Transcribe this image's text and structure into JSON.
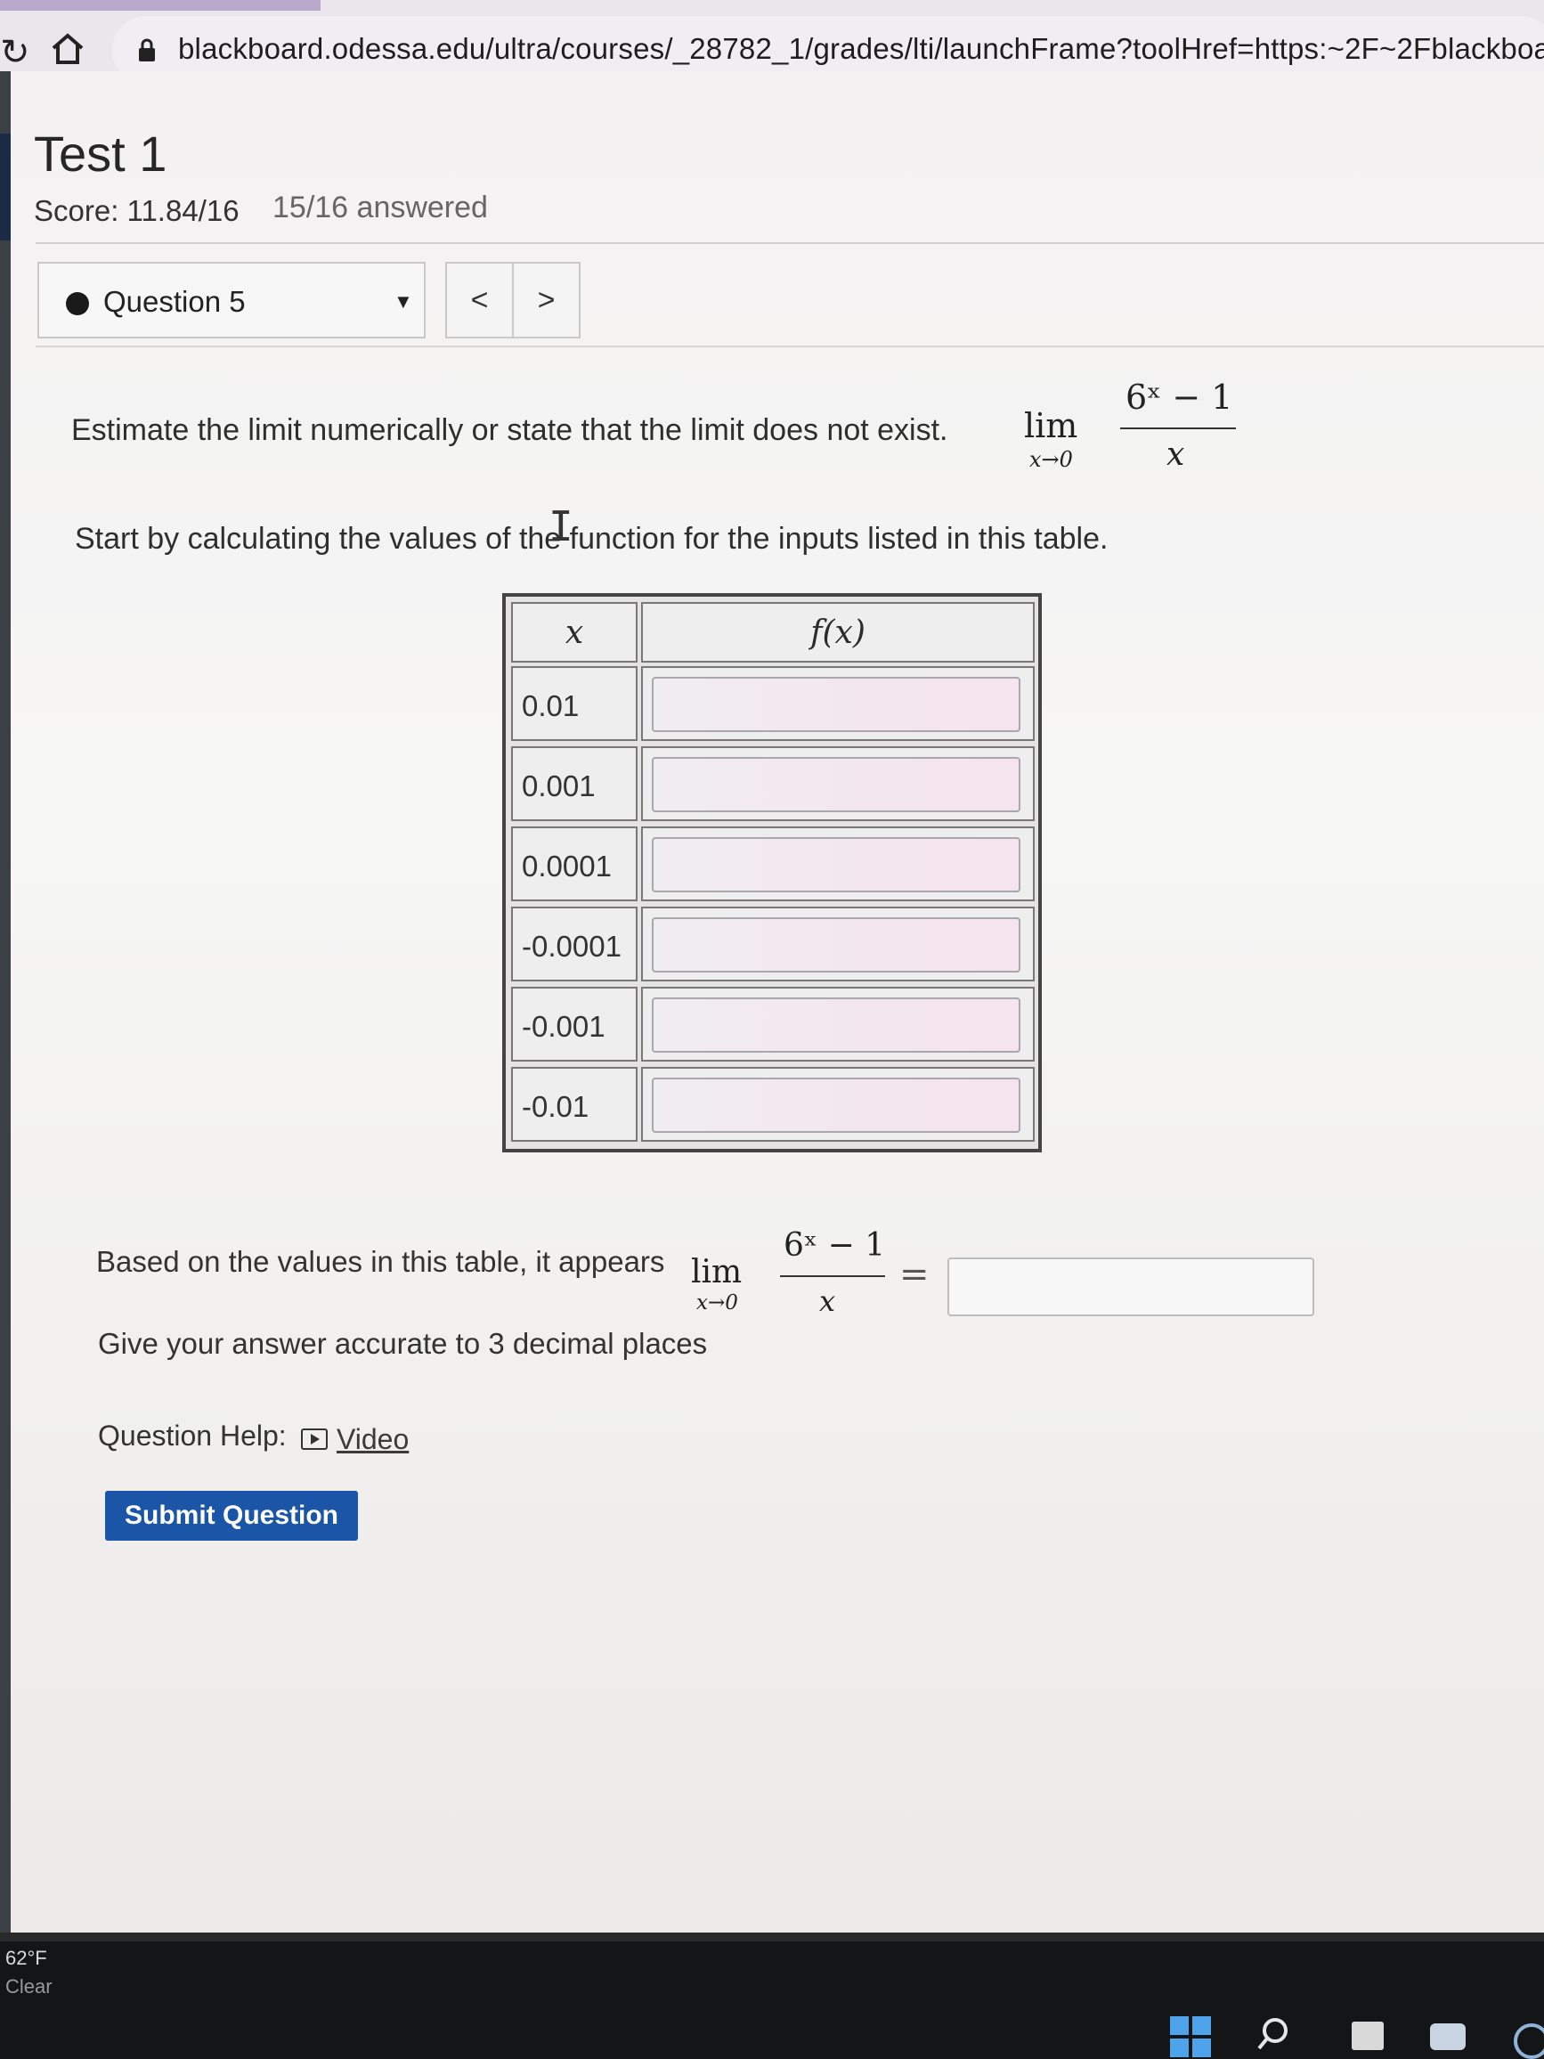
{
  "browser": {
    "url": "blackboard.odessa.edu/ultra/courses/_28782_1/grades/lti/launchFrame?toolHref=https:~2F~2Fblackboard"
  },
  "test": {
    "title": "Test 1",
    "score": "Score: 11.84/16",
    "answered": "15/16 answered"
  },
  "question_nav": {
    "selected": "Question 5",
    "prev": "<",
    "next": ">"
  },
  "question": {
    "prompt": "Estimate the limit numerically or state that the limit does not exist.",
    "lim": "lim",
    "lim_sub": "x→0",
    "numerator": "6ˣ − 1",
    "denominator": "x",
    "intro": "Start by calculating the values of the function for the inputs listed in this table.",
    "table_headers": {
      "x": "x",
      "fx": "f(x)"
    },
    "table_rows": [
      "0.01",
      "0.001",
      "0.0001",
      "-0.0001",
      "-0.001",
      "-0.01"
    ],
    "answer_text": "Based on the values in this table, it appears",
    "equals": "=",
    "accuracy": "Give your answer accurate to 3 decimal places",
    "help_label": "Question Help:",
    "video_label": "Video",
    "submit_label": "Submit Question"
  },
  "taskbar": {
    "temp": "62°F",
    "condition": "Clear"
  },
  "colors": {
    "submit": "#1b55a8",
    "windows": "#4ea3ea"
  }
}
